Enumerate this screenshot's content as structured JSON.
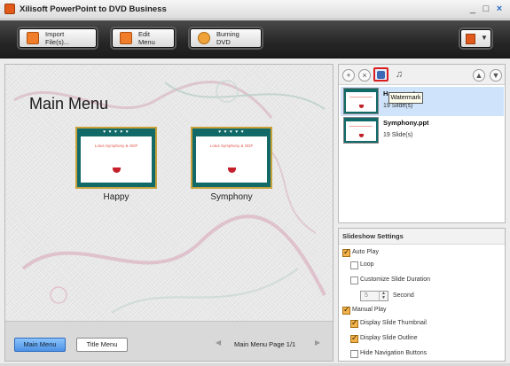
{
  "window": {
    "title": "Xilisoft PowerPoint to DVD Business",
    "controls": [
      "_",
      "□",
      "×"
    ]
  },
  "toolbar": {
    "import_label": "Import File(s)...",
    "edit_menu_label": "Edit Menu",
    "burning_label": "Burning DVD"
  },
  "preview": {
    "menu_title": "Main Menu",
    "items": [
      {
        "thumb_text": "Lotus Symphony & ODF",
        "label": "Happy"
      },
      {
        "thumb_text": "Lotus Symphony & ODF",
        "label": "Symphony"
      }
    ],
    "main_menu_btn": "Main Menu",
    "title_menu_btn": "Title Menu",
    "page_label": "Main Menu Page 1/1"
  },
  "right_toolbar": {
    "tooltip": "Watermark"
  },
  "slides": [
    {
      "name": "Happy.ppt",
      "count": "19 Slide(s)",
      "selected": true
    },
    {
      "name": "Symphony.ppt",
      "count": "19 Slide(s)",
      "selected": false
    }
  ],
  "settings": {
    "header": "Slideshow Settings",
    "auto_play": {
      "label": "Auto Play",
      "checked": true
    },
    "loop": {
      "label": "Loop",
      "checked": false
    },
    "custom_duration": {
      "label": "Customize Slide Duration",
      "checked": false
    },
    "duration_value": "5",
    "second_label": "Second",
    "manual_play": {
      "label": "Manual Play",
      "checked": true
    },
    "display_thumbnail": {
      "label": "Display Slide Thumbnail",
      "checked": true
    },
    "display_outline": {
      "label": "Display Slide Outline",
      "checked": true
    },
    "hide_nav": {
      "label": "Hide Navigation Buttons",
      "checked": false
    }
  },
  "colors": {
    "accent": "#4c92e6",
    "highlight": "#d81e1e",
    "thumb_bg": "#126a68",
    "thumb_border": "#c7a23b"
  }
}
